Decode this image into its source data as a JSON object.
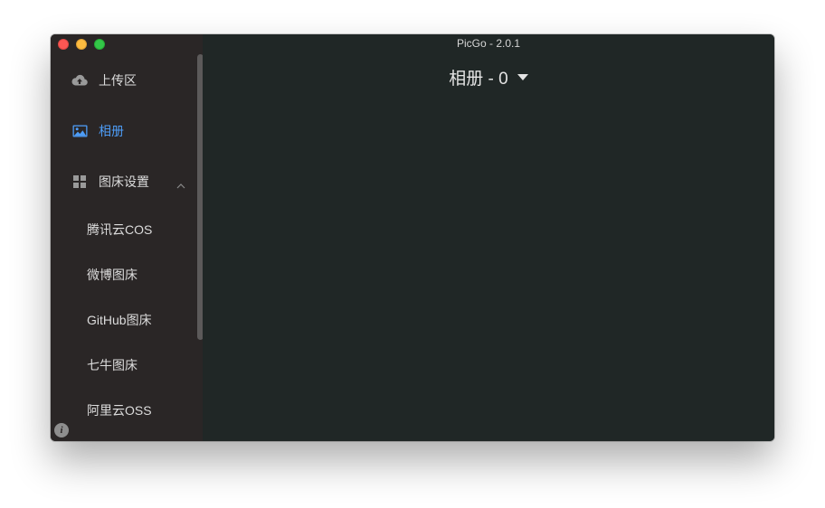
{
  "window": {
    "title": "PicGo - 2.0.1"
  },
  "sidebar": {
    "items": [
      {
        "label": "上传区",
        "icon": "cloud-upload-icon",
        "active": false
      },
      {
        "label": "相册",
        "icon": "image-icon",
        "active": true
      },
      {
        "label": "图床设置",
        "icon": "grid-icon",
        "active": false,
        "expanded": true
      }
    ],
    "sub_items": [
      {
        "label": "腾讯云COS"
      },
      {
        "label": "微博图床"
      },
      {
        "label": "GitHub图床"
      },
      {
        "label": "七牛图床"
      },
      {
        "label": "阿里云OSS"
      }
    ],
    "info_icon": "i"
  },
  "main": {
    "gallery_title": "相册 - 0"
  },
  "colors": {
    "sidebar_bg": "#2a2626",
    "main_bg": "#202726",
    "accent": "#4d9cf6",
    "text": "#dcdcdc"
  }
}
